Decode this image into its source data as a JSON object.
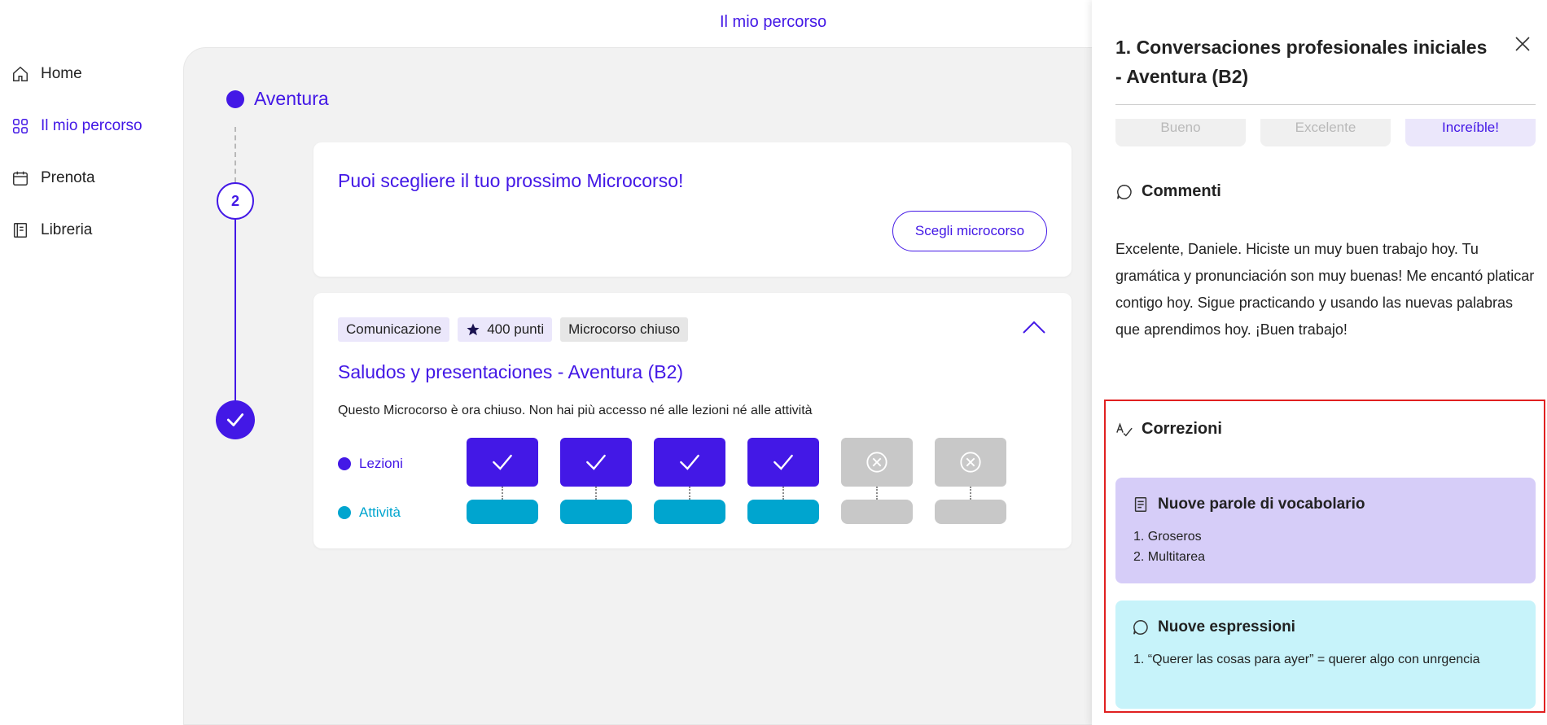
{
  "header": {
    "title": "Il mio percorso"
  },
  "sidebar": {
    "items": [
      {
        "label": "Home",
        "icon": "home-icon",
        "active": false
      },
      {
        "label": "Il mio percorso",
        "icon": "grid-icon",
        "active": true
      },
      {
        "label": "Prenota",
        "icon": "calendar-icon",
        "active": false
      },
      {
        "label": "Libreria",
        "icon": "book-icon",
        "active": false
      }
    ]
  },
  "path": {
    "title": "Aventura",
    "step_number": "2"
  },
  "next_card": {
    "title": "Puoi scegliere il tuo prossimo Microcorso!",
    "button_label": "Scegli microcorso"
  },
  "course_card": {
    "tags": {
      "category": "Comunicazione",
      "points": "400 punti",
      "status": "Microcorso chiuso"
    },
    "title": "Saludos y presentaciones - Aventura (B2)",
    "description": "Questo Microcorso è ora chiuso. Non hai più accesso né alle lezioni né alle attività",
    "lessons_label": "Lezioni",
    "activities_label": "Attività",
    "lessons_done_count": 4,
    "lessons_locked_count": 2
  },
  "panel": {
    "title": "1. Conversaciones profesionales iniciales - Aventura (B2)",
    "ratings": [
      "Bueno",
      "Excelente",
      "Increíble!"
    ],
    "comments_heading": "Commenti",
    "comment": "Excelente, Daniele. Hiciste un muy buen trabajo hoy. Tu gramática y pronunciación son muy buenas! Me encantó platicar contigo hoy. Sigue practicando y usando las nuevas palabras que aprendimos hoy. ¡Buen trabajo!",
    "corrections_heading": "Correzioni",
    "vocab": {
      "heading": "Nuove parole di vocabolario",
      "items": [
        "1. Groseros",
        "2. Multitarea"
      ]
    },
    "expressions": {
      "heading": "Nuove espressioni",
      "items": [
        "1. “Querer las cosas para ayer” = querer algo con unrgencia"
      ]
    }
  },
  "colors": {
    "accent": "#4318e6",
    "activity": "#00a5cf",
    "locked": "#c8c8c8",
    "vocab_bg": "#d6cdf8",
    "expr_bg": "#c7f3fa",
    "highlight": "#e02020"
  }
}
